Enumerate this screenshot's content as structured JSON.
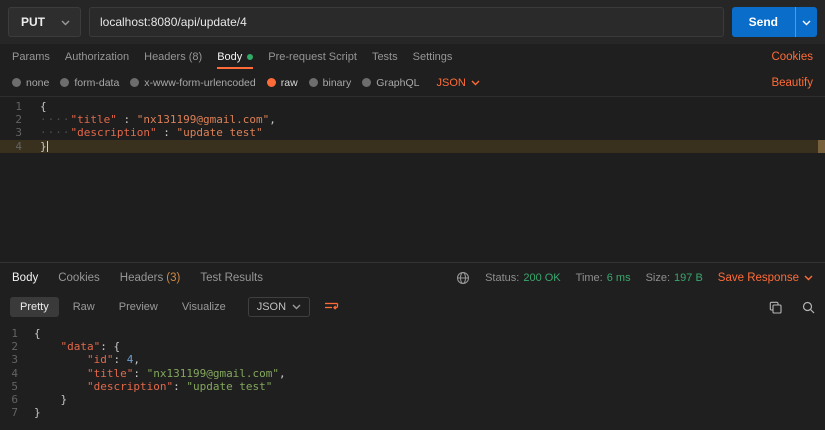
{
  "topbar": {
    "method": "PUT",
    "url": "localhost:8080/api/update/4",
    "send_label": "Send"
  },
  "request_tabs": {
    "items": [
      "Params",
      "Authorization",
      "Headers (8)",
      "Body",
      "Pre-request Script",
      "Tests",
      "Settings"
    ],
    "active": "Body",
    "cookies_link": "Cookies"
  },
  "body_type_row": {
    "options": [
      "none",
      "form-data",
      "x-www-form-urlencoded",
      "raw",
      "binary",
      "GraphQL"
    ],
    "selected": "raw",
    "language": "JSON",
    "beautify_link": "Beautify"
  },
  "request_editor": {
    "lines": [
      {
        "n": 1,
        "seg": [
          {
            "c": "p",
            "t": "{"
          }
        ]
      },
      {
        "n": 2,
        "seg": [
          {
            "c": "ws",
            "t": "····"
          },
          {
            "c": "k",
            "t": "\"title\""
          },
          {
            "c": "p",
            "t": " : "
          },
          {
            "c": "s",
            "t": "\"nx131199@gmail.com\""
          },
          {
            "c": "p",
            "t": ","
          }
        ]
      },
      {
        "n": 3,
        "seg": [
          {
            "c": "ws",
            "t": "····"
          },
          {
            "c": "k",
            "t": "\"description\""
          },
          {
            "c": "p",
            "t": " : "
          },
          {
            "c": "s",
            "t": "\"update test\""
          }
        ]
      },
      {
        "n": 4,
        "hl": true,
        "cursor": true,
        "seg": [
          {
            "c": "p",
            "t": "}"
          }
        ]
      }
    ]
  },
  "response_header": {
    "tab_body": "Body",
    "tab_cookies": "Cookies",
    "tab_headers": "Headers",
    "headers_count": "(3)",
    "tab_test_results": "Test Results",
    "status_label": "Status:",
    "status_value": "200 OK",
    "time_label": "Time:",
    "time_value": "6 ms",
    "size_label": "Size:",
    "size_value": "197 B",
    "save_response": "Save Response"
  },
  "response_toolbar": {
    "views": [
      "Pretty",
      "Raw",
      "Preview",
      "Visualize"
    ],
    "active": "Pretty",
    "language": "JSON"
  },
  "response_editor": {
    "lines": [
      {
        "n": 1,
        "seg": [
          {
            "c": "p",
            "t": "{"
          }
        ]
      },
      {
        "n": 2,
        "seg": [
          {
            "c": "ws",
            "t": "    "
          },
          {
            "c": "k",
            "t": "\"data\""
          },
          {
            "c": "p",
            "t": ": "
          },
          {
            "c": "p",
            "t": "{"
          }
        ]
      },
      {
        "n": 3,
        "seg": [
          {
            "c": "ws",
            "t": "        "
          },
          {
            "c": "k",
            "t": "\"id\""
          },
          {
            "c": "p",
            "t": ": "
          },
          {
            "c": "n",
            "t": "4"
          },
          {
            "c": "p",
            "t": ","
          }
        ]
      },
      {
        "n": 4,
        "seg": [
          {
            "c": "ws",
            "t": "        "
          },
          {
            "c": "k",
            "t": "\"title\""
          },
          {
            "c": "p",
            "t": ": "
          },
          {
            "c": "s",
            "t": "\"nx131199@gmail.com\""
          },
          {
            "c": "p",
            "t": ","
          }
        ]
      },
      {
        "n": 5,
        "seg": [
          {
            "c": "ws",
            "t": "        "
          },
          {
            "c": "k",
            "t": "\"description\""
          },
          {
            "c": "p",
            "t": ": "
          },
          {
            "c": "s",
            "t": "\"update test\""
          }
        ]
      },
      {
        "n": 6,
        "seg": [
          {
            "c": "ws",
            "t": "    "
          },
          {
            "c": "p",
            "t": "}"
          }
        ]
      },
      {
        "n": 7,
        "seg": [
          {
            "c": "p",
            "t": "}"
          }
        ]
      }
    ]
  },
  "icons": {
    "method_caret": "chevron-down",
    "send_caret": "chevron-down",
    "language_caret": "chevron-down",
    "save_caret": "chevron-down",
    "network": "globe",
    "wrap": "wrap-text",
    "copy": "copy",
    "search": "magnifier"
  },
  "colors": {
    "accent_orange": "#ff6c37",
    "send_blue": "#0b6dca",
    "success_green": "#3aa76d"
  }
}
